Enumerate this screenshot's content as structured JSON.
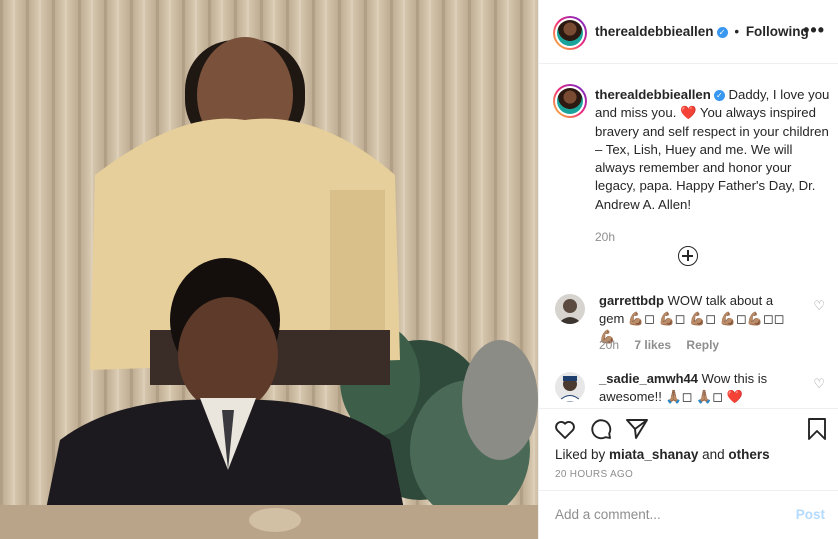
{
  "post": {
    "username": "therealdebbieallen",
    "follow_status": "Following",
    "more_label": "•••",
    "caption": "Daddy, I love you and miss you. ❤️ You always inspired bravery and self respect in your children – Tex, Lish, Huey and me. We will always remember and honor your legacy, papa. Happy Father's Day, Dr. Andrew A. Allen!",
    "caption_time": "20h"
  },
  "comments": [
    {
      "username": "garrettbdp",
      "text": "WOW talk about a gem 💪🏽◻ 💪🏽◻ 💪🏽◻ 💪🏽◻💪🏽◻◻💪🏽",
      "time": "20h",
      "likes": "7 likes",
      "reply": "Reply"
    },
    {
      "username": "_sadie_amwh44",
      "text": "Wow this is awesome!! 🙏🏽◻ 🙏🏽◻ ❤️",
      "time": "",
      "likes": "",
      "reply": ""
    }
  ],
  "likes_text": {
    "prefix": "Liked by ",
    "user": "miata_shanay",
    "middle": " and ",
    "others": "others"
  },
  "posted_ago": "20 HOURS AGO",
  "add_comment": {
    "placeholder": "Add a comment...",
    "post_label": "Post"
  },
  "colors": {
    "verified": "#3897f0",
    "like_heart": "#ed4956",
    "post_disabled": "#b3dbff",
    "muted": "#8e8e8e"
  },
  "icons": [
    "verified-badge-icon",
    "more-options-icon",
    "load-more-icon",
    "heart-icon",
    "comment-icon",
    "share-icon",
    "bookmark-icon"
  ]
}
